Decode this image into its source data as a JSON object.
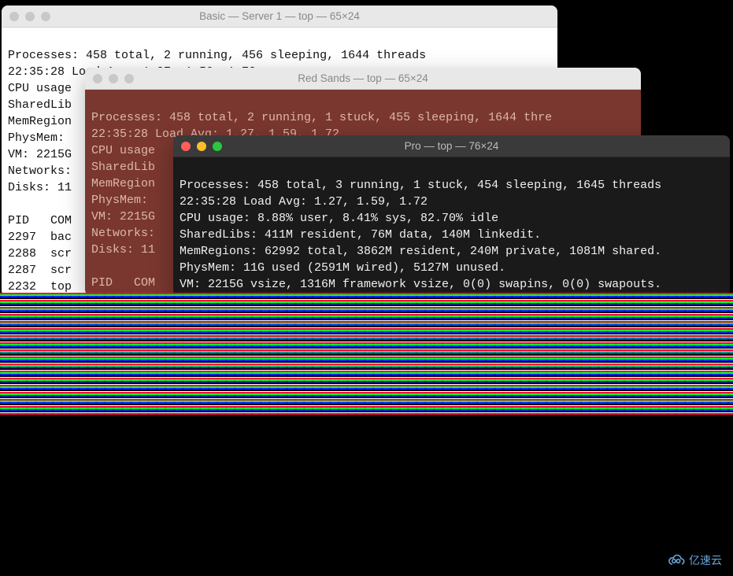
{
  "windows": {
    "basic": {
      "title": "Basic — Server 1 — top — 65×24",
      "lines": [
        "Processes: 458 total, 2 running, 456 sleeping, 1644 threads",
        "22:35:28 Load Avg: 1.27, 1.59, 1.72",
        "CPU usage",
        "SharedLib",
        "MemRegion",
        "PhysMem:",
        "VM: 2215G",
        "Networks:",
        "Disks: 11",
        "",
        "PID   COM",
        "2297  bac",
        "2288  scr",
        "2287  scr",
        "2232  top"
      ]
    },
    "red": {
      "title": "Red Sands — top — 65×24",
      "lines": [
        "Processes: 458 total, 2 running, 1 stuck, 455 sleeping, 1644 thre",
        "22:35:28 Load Avg: 1.27, 1.59, 1.72",
        "CPU usage",
        "SharedLib",
        "MemRegion",
        "PhysMem:",
        "VM: 2215G",
        "Networks:",
        "Disks: 11",
        "",
        "PID   COM"
      ]
    },
    "pro": {
      "title": "Pro — top — 76×24",
      "lines": [
        "Processes: 458 total, 3 running, 1 stuck, 454 sleeping, 1645 threads",
        "22:35:28 Load Avg: 1.27, 1.59, 1.72",
        "CPU usage: 8.88% user, 8.41% sys, 82.70% idle",
        "SharedLibs: 411M resident, 76M data, 140M linkedit.",
        "MemRegions: 62992 total, 3862M resident, 240M private, 1081M shared.",
        "PhysMem: 11G used (2591M wired), 5127M unused.",
        "VM: 2215G vsize, 1316M framework vsize, 0(0) swapins, 0(0) swapouts."
      ]
    }
  },
  "watermark": {
    "text": "亿速云"
  }
}
